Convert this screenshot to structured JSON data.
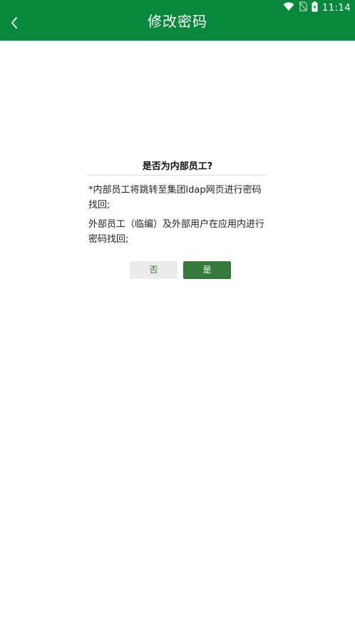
{
  "status_bar": {
    "time": "11:14",
    "icons": [
      "wifi-icon",
      "no-sim-icon",
      "battery-charging-icon"
    ]
  },
  "header": {
    "title": "修改密码",
    "back_icon": "chevron-left-icon"
  },
  "dialog": {
    "title": "是否为内部员工?",
    "message_1": "*内部员工将跳转至集团ldap网页进行密码找回;",
    "message_2": "外部员工（临编）及外部用户在应用内进行密码找回;",
    "no_label": "否",
    "yes_label": "是"
  },
  "colors": {
    "app_bar": "#07883d",
    "yes_button": "#357a3d",
    "no_button_bg": "#ebebeb",
    "no_button_text": "#2f7a3c"
  }
}
